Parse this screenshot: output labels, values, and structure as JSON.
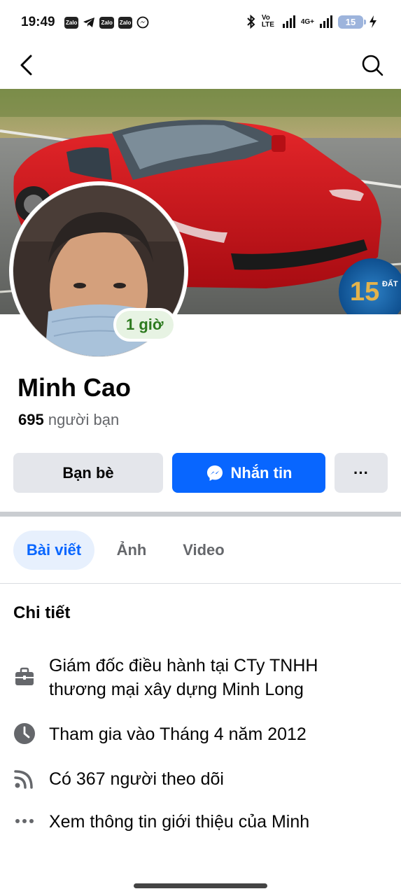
{
  "status_bar": {
    "time": "19:49",
    "apps": [
      "Zalo",
      "Zalo",
      "Zalo"
    ],
    "network": "4G+",
    "volte": "Vo LTE",
    "battery": "15"
  },
  "profile": {
    "name": "Minh Cao",
    "friends_count": "695",
    "friends_label": "người bạn",
    "active_badge": "1 giờ"
  },
  "cover": {
    "logo_text": "15",
    "logo_side": "ĐẤT",
    "brand": "ĐẤT XANH GROUP"
  },
  "actions": {
    "friends": "Bạn bè",
    "message": "Nhắn tin",
    "more": "···"
  },
  "tabs": [
    {
      "label": "Bài viết",
      "active": true
    },
    {
      "label": "Ảnh",
      "active": false
    },
    {
      "label": "Video",
      "active": false
    }
  ],
  "details": {
    "title": "Chi tiết",
    "work": "Giám đốc điều hành tại CTy TNHH thương mại xây dựng Minh Long",
    "joined": "Tham gia vào Tháng 4 năm 2012",
    "followers": "Có 367 người theo dõi",
    "about": "Xem thông tin giới thiệu của Minh"
  },
  "icons": {
    "back": "back-arrow-icon",
    "search": "search-icon",
    "messenger": "messenger-icon",
    "work": "briefcase-icon",
    "joined": "clock-icon",
    "followers": "rss-icon",
    "about": "ellipsis-icon"
  },
  "colors": {
    "primary": "#0866ff",
    "secondary_button": "#e4e6eb",
    "active_tab_bg": "#e7f0fd",
    "badge_bg": "#e7f3e3",
    "badge_text": "#2d7a1f"
  }
}
